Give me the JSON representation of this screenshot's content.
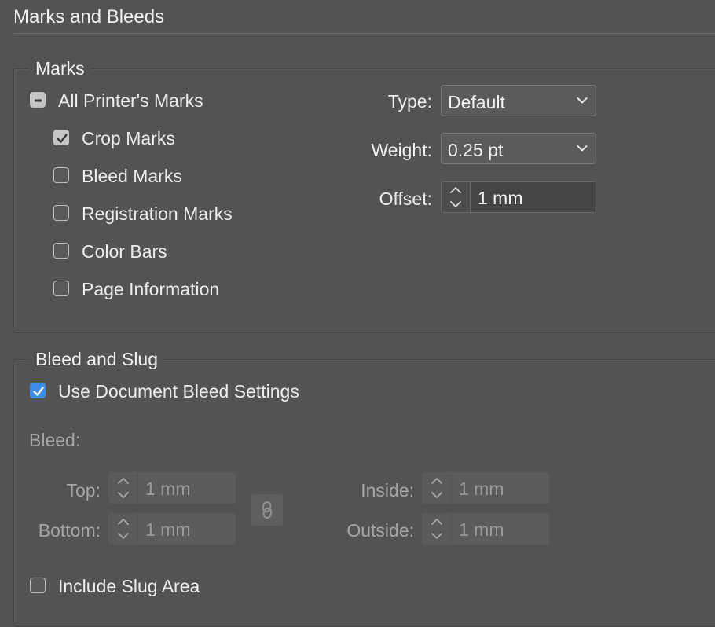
{
  "panel": {
    "title": "Marks and Bleeds"
  },
  "marks": {
    "legend": "Marks",
    "all_printers_marks": {
      "label": "All Printer's Marks",
      "state": "mixed"
    },
    "crop_marks": {
      "label": "Crop Marks",
      "checked": true
    },
    "bleed_marks": {
      "label": "Bleed Marks",
      "checked": false
    },
    "registration_marks": {
      "label": "Registration Marks",
      "checked": false
    },
    "color_bars": {
      "label": "Color Bars",
      "checked": false
    },
    "page_information": {
      "label": "Page Information",
      "checked": false
    },
    "type": {
      "label": "Type:",
      "value": "Default"
    },
    "weight": {
      "label": "Weight:",
      "value": "0.25 pt"
    },
    "offset": {
      "label": "Offset:",
      "value": "1 mm"
    }
  },
  "bleed_slug": {
    "legend": "Bleed and Slug",
    "use_document_bleed": {
      "label": "Use Document Bleed Settings",
      "checked": true
    },
    "bleed_label": "Bleed:",
    "top": {
      "label": "Top:",
      "value": "1 mm"
    },
    "bottom": {
      "label": "Bottom:",
      "value": "1 mm"
    },
    "inside": {
      "label": "Inside:",
      "value": "1 mm"
    },
    "outside": {
      "label": "Outside:",
      "value": "1 mm"
    },
    "link_icon": "chain-link-icon",
    "include_slug": {
      "label": "Include Slug Area",
      "checked": false
    }
  },
  "colors": {
    "background": "#535353",
    "checkbox_accent": "#3d8ee6"
  }
}
